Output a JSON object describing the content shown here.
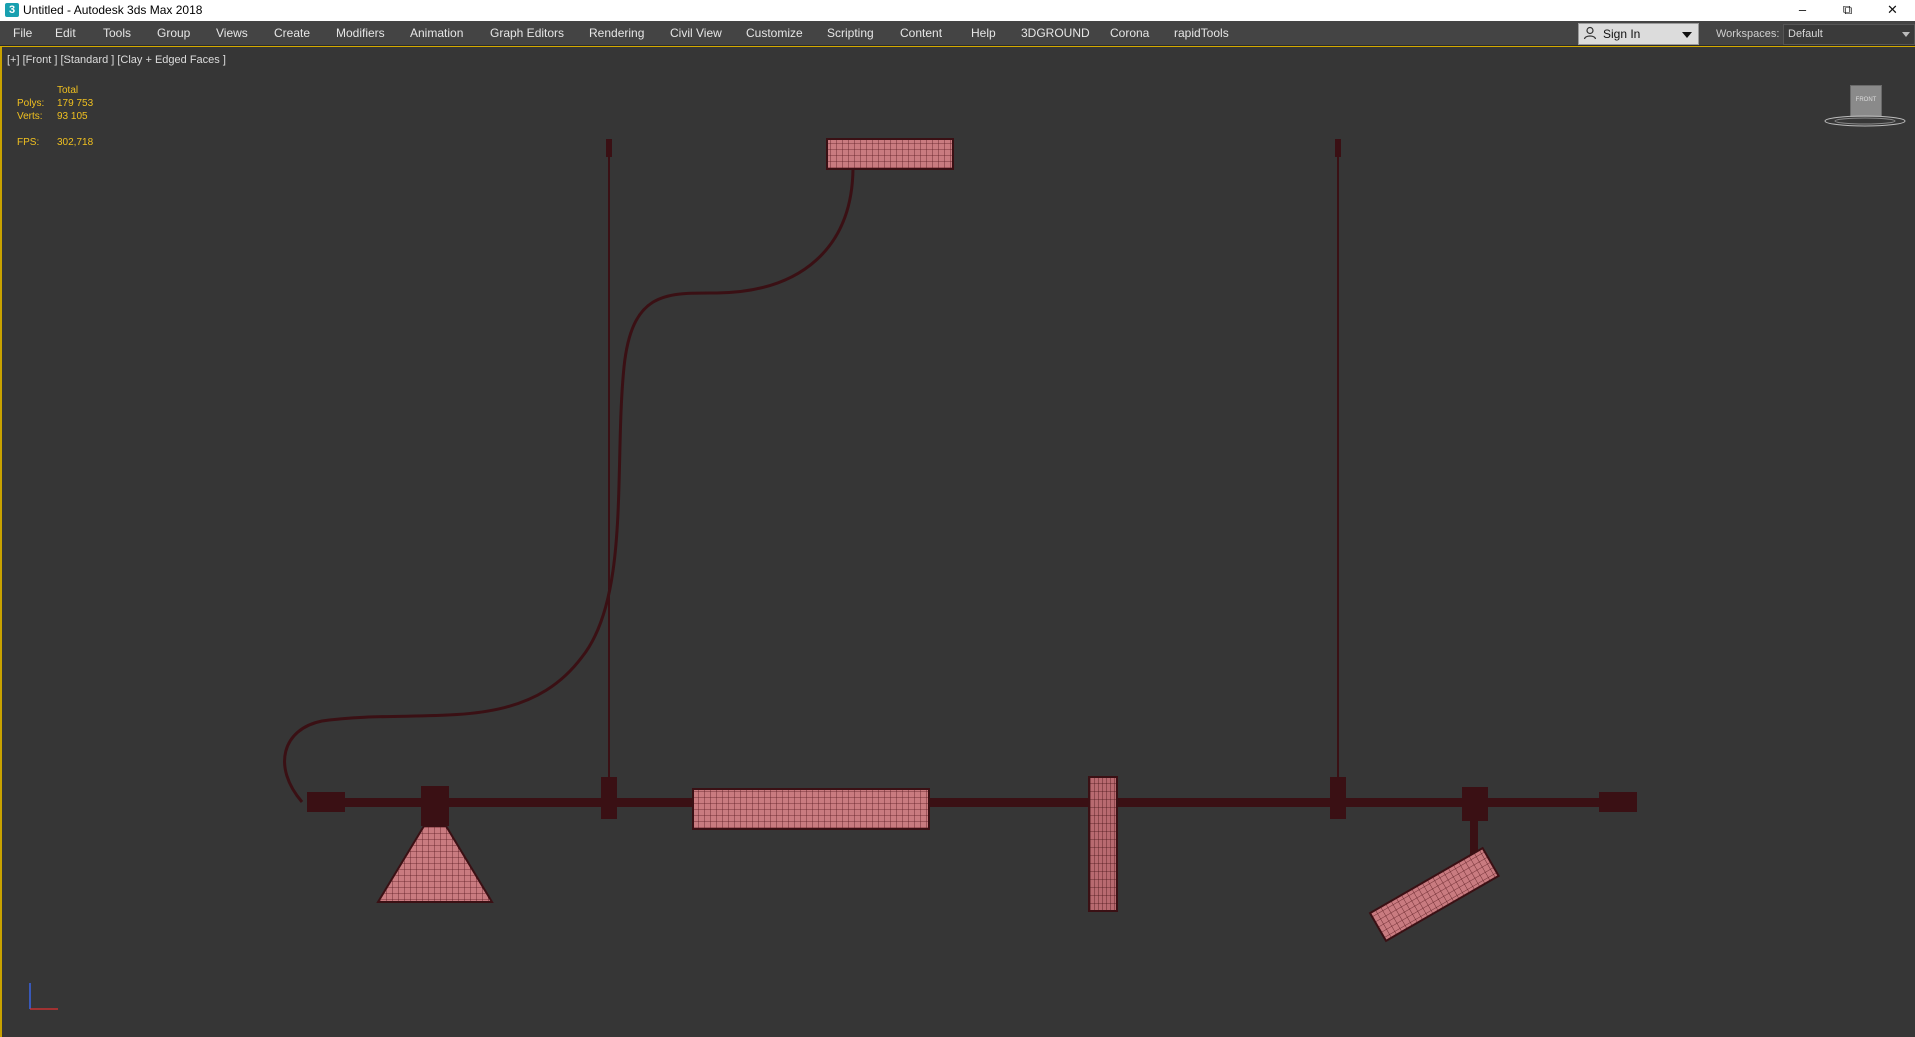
{
  "window": {
    "title": "Untitled - Autodesk 3ds Max 2018",
    "icon": "3ds-max-app-icon",
    "controls": {
      "minimize": "–",
      "maximize": "⧉",
      "close": "✕"
    }
  },
  "menubar": {
    "items": [
      "File",
      "Edit",
      "Tools",
      "Group",
      "Views",
      "Create",
      "Modifiers",
      "Animation",
      "Graph Editors",
      "Rendering",
      "Civil View",
      "Customize",
      "Scripting",
      "Content",
      "Help",
      "3DGROUND",
      "Corona",
      "rapidTools"
    ],
    "sign_in": {
      "label": "Sign In",
      "icon": "user-icon"
    },
    "workspaces": {
      "label": "Workspaces:",
      "value": "Default"
    }
  },
  "viewport": {
    "label": "[+] [Front ] [Standard ] [Clay + Edged Faces ]",
    "stats": {
      "header": "Total",
      "polys_label": "Polys:",
      "polys": "179 753",
      "verts_label": "Verts:",
      "verts": "93 105",
      "fps_label": "FPS:",
      "fps": "302,718"
    },
    "viewcube_label": "FRONT",
    "colors": {
      "background": "#363636",
      "wire": "#3a1014",
      "mesh_fill": "#c97b80",
      "stats_text": "#f0c020",
      "active_border": "#c8a200"
    }
  }
}
